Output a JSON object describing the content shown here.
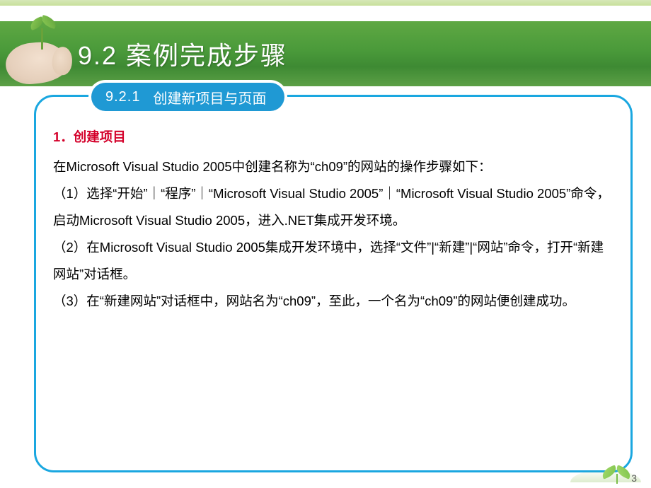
{
  "header": {
    "title": "9.2 案例完成步骤"
  },
  "subheader": {
    "number": "9.2.1",
    "text": "创建新项目与页面"
  },
  "content": {
    "section_title": "1．创建项目",
    "intro": "在Microsoft Visual Studio 2005中创建名称为“ch09”的网站的操作步骤如下：",
    "step1": "（1）选择“开始”｜“程序”｜“Microsoft Visual Studio 2005”｜“Microsoft Visual Studio 2005”命令，启动Microsoft Visual Studio 2005，进入.NET集成开发环境。",
    "step2": "（2）在Microsoft Visual Studio 2005集成开发环境中，选择“文件”|“新建”|“网站”命令，打开“新建网站”对话框。",
    "step3": "（3）在“新建网站”对话框中，网站名为“ch09”，至此，一个名为“ch09”的网站便创建成功。"
  },
  "page_number": "3"
}
